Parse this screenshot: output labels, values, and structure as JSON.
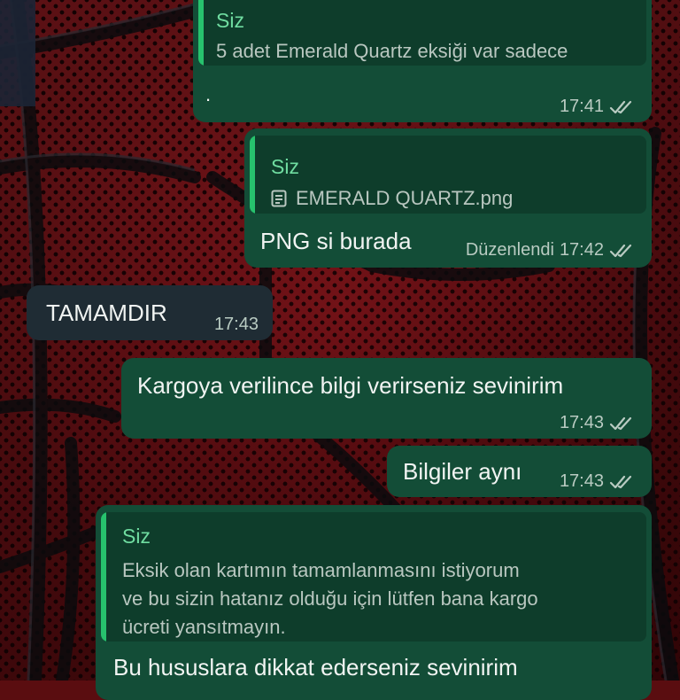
{
  "messages": [
    {
      "id": "m1",
      "direction": "out",
      "quote_sender": "Siz",
      "quote_text": "5 adet Emerald Quartz eksiği var sadece",
      "text": ".",
      "time": "17:41",
      "status": "read"
    },
    {
      "id": "m2",
      "direction": "out",
      "quote_sender": "Siz",
      "quote_file": "EMERALD QUARTZ.png",
      "quote_file_icon": "document-icon",
      "text": "PNG si burada",
      "edited_label": "Düzenlendi",
      "time": "17:42",
      "status": "read"
    },
    {
      "id": "m3",
      "direction": "in",
      "text": "TAMAMDIR",
      "time": "17:43"
    },
    {
      "id": "m4",
      "direction": "out",
      "text": "Kargoya verilince bilgi verirseniz sevinirim",
      "time": "17:43",
      "status": "read"
    },
    {
      "id": "m5",
      "direction": "out",
      "text": "Bilgiler aynı",
      "time": "17:43",
      "status": "read"
    },
    {
      "id": "m6",
      "direction": "out",
      "quote_sender": "Siz",
      "quote_lines": [
        "Eksik olan kartımın tamamlanmasını istiyorum",
        "ve bu sizin hatanız olduğu için lütfen bana kargo",
        "ücreti yansıtmayın."
      ],
      "text": "Bu hususlara dikkat ederseniz sevinirim"
    }
  ],
  "colors": {
    "outgoing_bubble": "#134d37",
    "incoming_bubble": "#1f2c34",
    "quote_bar": "#27c26d",
    "quote_name": "#6fdca0",
    "wallpaper": "#6c1015"
  }
}
